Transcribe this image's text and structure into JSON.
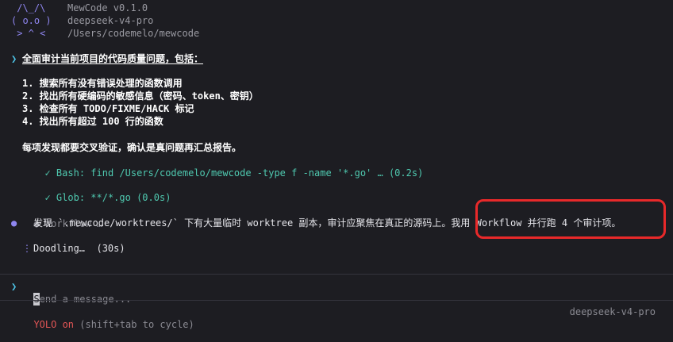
{
  "banner": {
    "logo_line1": " /\\_/\\",
    "logo_line2": "( o.o )",
    "logo_line3": " > ^ <",
    "app_version": "MewCode v0.1.0",
    "model": "deepseek-v4-pro",
    "cwd": "/Users/codemelo/mewcode"
  },
  "prompt": {
    "caret": "❯",
    "title": "全面审计当前项目的代码质量问题，包括：",
    "items": [
      "1. 搜索所有没有错误处理的函数调用",
      "2. 找出所有硬编码的敏感信息（密码、token、密钥）",
      "3. 检查所有 TODO/FIXME/HACK 标记",
      "4. 找出所有超过 100 行的函数"
    ],
    "footer": "每项发现都要交叉验证，确认是真问题再汇总报告。"
  },
  "tools": [
    {
      "icon": "✓",
      "text": "Bash: find /Users/codemelo/mewcode -type f -name '*.go' … (0.2s)"
    },
    {
      "icon": "✓",
      "text": "Glob: **/*.go (0.0s)"
    }
  ],
  "workflow": {
    "icon": "●",
    "label": "Workflow …"
  },
  "assistant": {
    "icon": "●",
    "message": "发现 `.mewcode/worktrees/` 下有大量临时 worktree 副本，审计应聚焦在真正的源码上。我用 Workflow 并行跑 4 个审计项。"
  },
  "status": {
    "spinner": "⋮",
    "text": "Doodling…  (30s)"
  },
  "input": {
    "caret": "❯",
    "cursor_char": "S",
    "placeholder_rest": "end a message..."
  },
  "footer": {
    "yolo": "YOLO on",
    "hint": " (shift+tab to cycle)",
    "model": "deepseek-v4-pro"
  },
  "colors": {
    "background": "#1d1d22",
    "accent_purple": "#8f86f0",
    "accent_cyan": "#4dc3e6",
    "success_teal": "#4fc9b0",
    "warning_red": "#e45656",
    "highlight_red": "#e8292a"
  }
}
